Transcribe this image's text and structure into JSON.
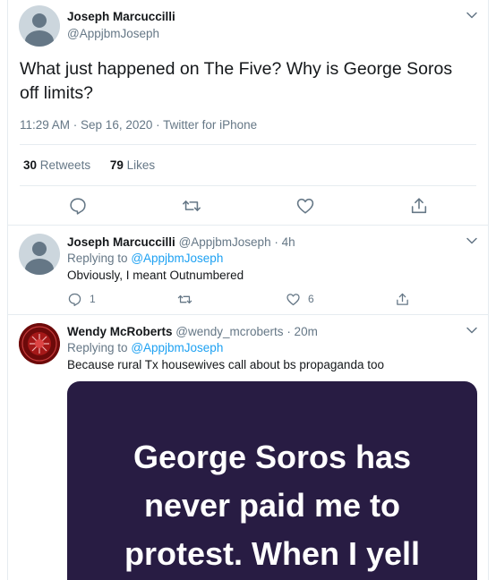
{
  "main_tweet": {
    "author_name": "Joseph Marcuccilli",
    "author_handle": "@AppjbmJoseph",
    "text": "What just happened on The Five?  Why is George Soros off limits?",
    "meta": "11:29 AM · Sep 16, 2020 · Twitter for iPhone",
    "retweets_count": "30",
    "retweets_label": "Retweets",
    "likes_count": "79",
    "likes_label": "Likes"
  },
  "replies": [
    {
      "author_name": "Joseph Marcuccilli",
      "author_handle": "@AppjbmJoseph",
      "time": "· 4h",
      "replying_prefix": "Replying to",
      "replying_handle": "@AppjbmJoseph",
      "text": "Obviously, I meant Outnumbered",
      "reply_count": "1",
      "retweet_count": "",
      "like_count": "6"
    },
    {
      "author_name": "Wendy McRoberts",
      "author_handle": "@wendy_mcroberts",
      "time": "· 20m",
      "replying_prefix": "Replying to",
      "replying_handle": "@AppjbmJoseph",
      "text": "Because rural Tx housewives call about bs propaganda too",
      "media_text": [
        "George Soros has",
        "never paid me to",
        "protest. When I yell"
      ]
    }
  ],
  "icons": {
    "reply": "reply-icon",
    "retweet": "retweet-icon",
    "like": "heart-icon",
    "share": "share-icon",
    "more": "chevron-down-icon"
  },
  "colors": {
    "accent": "#1da1f2",
    "secondary_text": "#657786",
    "divider": "#e6ecf0",
    "media_background": "#281c43"
  }
}
